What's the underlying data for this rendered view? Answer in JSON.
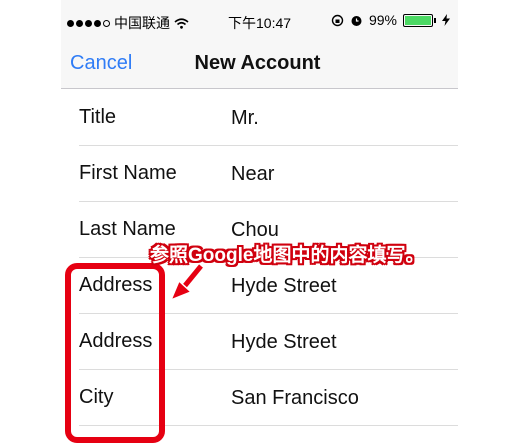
{
  "status": {
    "carrier": "中国联通",
    "time": "下午10:47",
    "battery": "99%",
    "battery_level": 0.99
  },
  "nav": {
    "cancel": "Cancel",
    "title": "New Account"
  },
  "rows": [
    {
      "label": "Title",
      "value": "Mr."
    },
    {
      "label": "First Name",
      "value": "Near"
    },
    {
      "label": "Last Name",
      "value": "Chou"
    },
    {
      "label": "Address",
      "value": "Hyde Street"
    },
    {
      "label": "Address",
      "value": "Hyde Street"
    },
    {
      "label": "City",
      "value": "San Francisco"
    },
    {
      "label": "",
      "value": ""
    }
  ],
  "annotation": "参照Google地图中的内容填写。",
  "colors": {
    "accent": "#2f7cf6",
    "annotation_red": "#e60012",
    "battery_green": "#4cd964"
  }
}
